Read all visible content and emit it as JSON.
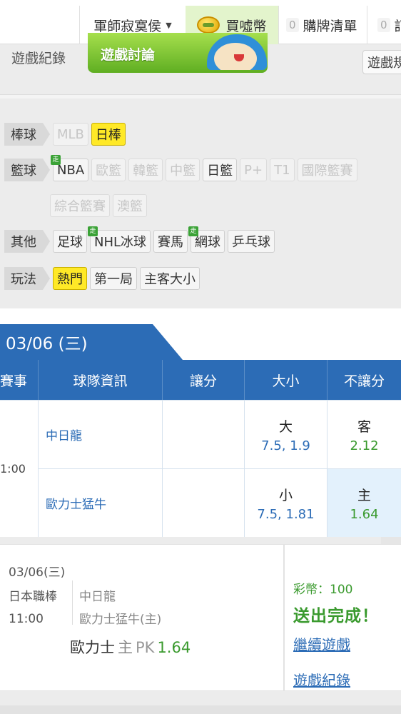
{
  "nav": {
    "user": "軍師寂寞侯",
    "buy_coins": "買噓幣",
    "cart_count": "0",
    "cart_label": "購牌清單",
    "edge_count": "0",
    "edge_label": "訂"
  },
  "subnav": {
    "game_record": "遊戲紀錄",
    "game_discussion": "遊戲討論",
    "game_rules": "遊戲規"
  },
  "filters": {
    "baseball": {
      "label": "棒球",
      "items": [
        "MLB",
        "日棒"
      ]
    },
    "basketball": {
      "label": "籃球",
      "items": [
        "NBA",
        "歐籃",
        "韓籃",
        "中籃",
        "日籃",
        "P+",
        "T1",
        "國際籃賽",
        "綜合籃賽",
        "澳籃"
      ]
    },
    "other": {
      "label": "其他",
      "items": [
        "足球",
        "NHL冰球",
        "賽馬",
        "網球",
        "乒乓球"
      ]
    },
    "play": {
      "label": "玩法",
      "items": [
        "熱門",
        "第一局",
        "主客大小"
      ]
    },
    "walk_badge": "走"
  },
  "odds": {
    "date": "03/06 (三)",
    "headers": [
      "賽事",
      "球隊資訊",
      "讓分",
      "大小",
      "不讓分"
    ],
    "time": "1:00",
    "away_team": "中日龍",
    "home_team": "歐力士猛牛",
    "over_label": "大",
    "over_odds": "7.5, 1.9",
    "under_label": "小",
    "under_odds": "7.5, 1.81",
    "away_ml_label": "客",
    "away_ml": "2.12",
    "home_ml_label": "主",
    "home_ml": "1.64"
  },
  "receipt": {
    "date": "03/06(三)",
    "league": "日本職棒",
    "time": "11:00",
    "away": "中日龍",
    "home": "歐力士猛牛(主)",
    "pick_team": "歐力士",
    "pick_side": "主",
    "pick_type": "PK",
    "pick_odds": "1.64",
    "coins": "彩幣：100",
    "status": "送出完成！",
    "continue": "繼續遊戲",
    "record": "遊戲紀錄"
  },
  "colors": {
    "primary_blue": "#2c6cb6",
    "highlight_yellow": "#ffe927",
    "success_green": "#3a9a2e"
  }
}
